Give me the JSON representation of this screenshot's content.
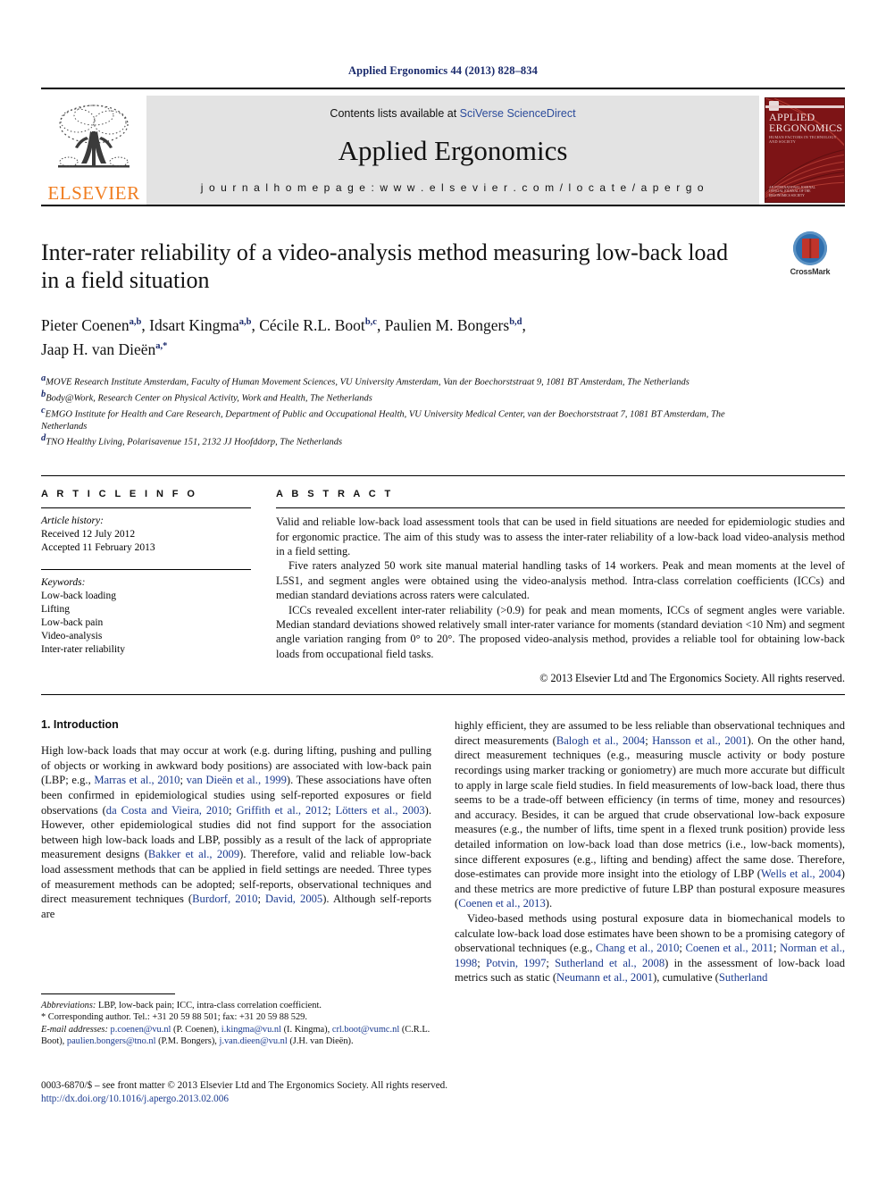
{
  "running_head": "Applied Ergonomics 44 (2013) 828–834",
  "banner": {
    "publisher_name": "ELSEVIER",
    "contents_prefix": "Contents lists available at ",
    "contents_link": "SciVerse ScienceDirect",
    "journal_title": "Applied Ergonomics",
    "homepage": "j o u r n a l   h o m e p a g e :   w w w . e l s e v i e r . c o m / l o c a t e / a p e r g o",
    "cover": {
      "title_line1": "APPLIED",
      "title_line2": "ERGONOMICS",
      "subtitle": "HUMAN FACTORS IN TECHNOLOGY AND SOCIETY",
      "footer": "AN INTERNATIONAL JOURNAL\nOFFICIAL JOURNAL OF THE ERGONOMICS SOCIETY"
    }
  },
  "article": {
    "title": "Inter-rater reliability of a video-analysis method measuring low-back load in a field situation",
    "crossmark_label": "CrossMark",
    "authors": [
      {
        "name": "Pieter Coenen",
        "sup": "a,b",
        "sep": ", "
      },
      {
        "name": "Idsart Kingma",
        "sup": "a,b",
        "sep": ", "
      },
      {
        "name": "Cécile R.L. Boot",
        "sup": "b,c",
        "sep": ", "
      },
      {
        "name": "Paulien M. Bongers",
        "sup": "b,d",
        "sep": ", "
      },
      {
        "name": "Jaap H. van Dieën",
        "sup": "a,*",
        "sep": ""
      }
    ],
    "affiliations": [
      {
        "sup": "a",
        "text": "MOVE Research Institute Amsterdam, Faculty of Human Movement Sciences, VU University Amsterdam, Van der Boechorststraat 9, 1081 BT Amsterdam, The Netherlands"
      },
      {
        "sup": "b",
        "text": "Body@Work, Research Center on Physical Activity, Work and Health, The Netherlands"
      },
      {
        "sup": "c",
        "text": "EMGO Institute for Health and Care Research, Department of Public and Occupational Health, VU University Medical Center, van der Boechorststraat 7, 1081 BT Amsterdam, The Netherlands"
      },
      {
        "sup": "d",
        "text": "TNO Healthy Living, Polarisavenue 151, 2132 JJ Hoofddorp, The Netherlands"
      }
    ]
  },
  "article_info": {
    "heading": "A R T I C L E  I N F O",
    "history_label": "Article history:",
    "received": "Received 12 July 2012",
    "accepted": "Accepted 11 February 2013",
    "keywords_label": "Keywords:",
    "keywords": [
      "Low-back loading",
      "Lifting",
      "Low-back pain",
      "Video-analysis",
      "Inter-rater reliability"
    ]
  },
  "abstract": {
    "heading": "A B S T R A C T",
    "paragraphs": [
      "Valid and reliable low-back load assessment tools that can be used in field situations are needed for epidemiologic studies and for ergonomic practice. The aim of this study was to assess the inter-rater reliability of a low-back load video-analysis method in a field setting.",
      "Five raters analyzed 50 work site manual material handling tasks of 14 workers. Peak and mean moments at the level of L5S1, and segment angles were obtained using the video-analysis method. Intra-class correlation coefficients (ICCs) and median standard deviations across raters were calculated.",
      "ICCs revealed excellent inter-rater reliability (>0.9) for peak and mean moments, ICCs of segment angles were variable. Median standard deviations showed relatively small inter-rater variance for moments (standard deviation <10 Nm) and segment angle variation ranging from 0° to 20°. The proposed video-analysis method, provides a reliable tool for obtaining low-back loads from occupational field tasks."
    ],
    "copyright": "© 2013 Elsevier Ltd and The Ergonomics Society. All rights reserved."
  },
  "introduction": {
    "section_number_title": "1.  Introduction",
    "left_column_html": "High low-back loads that may occur at work (e.g. during lifting, pushing and pulling of objects or working in awkward body positions) are associated with low-back pain (LBP; e.g., <span class=\"cit\">Marras et al., 2010</span>; <span class=\"cit\">van Dieën et al., 1999</span>). These associations have often been confirmed in epidemiological studies using self-reported exposures or field observations (<span class=\"cit\">da Costa and Vieira, 2010</span>; <span class=\"cit\">Griffith et al., 2012</span>; <span class=\"cit\">Lötters et al., 2003</span>). However, other epidemiological studies did not find support for the association between high low-back loads and LBP, possibly as a result of the lack of appropriate measurement designs (<span class=\"cit\">Bakker et al., 2009</span>). Therefore, valid and reliable low-back load assessment methods that can be applied in field settings are needed. Three types of measurement methods can be adopted; self-reports, observational techniques and direct measurement techniques (<span class=\"cit\">Burdorf, 2010</span>; <span class=\"cit\">David, 2005</span>). Although self-reports are",
    "right_column_html_1": "highly efficient, they are assumed to be less reliable than observational techniques and direct measurements (<span class=\"cit\">Balogh et al., 2004</span>; <span class=\"cit\">Hansson et al., 2001</span>). On the other hand, direct measurement techniques (e.g., measuring muscle activity or body posture recordings using marker tracking or goniometry) are much more accurate but difficult to apply in large scale field studies. In field measurements of low-back load, there thus seems to be a trade-off between efficiency (in terms of time, money and resources) and accuracy. Besides, it can be argued that crude observational low-back exposure measures (e.g., the number of lifts, time spent in a flexed trunk position) provide less detailed information on low-back load than dose metrics (i.e., low-back moments), since different exposures (e.g., lifting and bending) affect the same dose. Therefore, dose-estimates can provide more insight into the etiology of LBP (<span class=\"cit\">Wells et al., 2004</span>) and these metrics are more predictive of future LBP than postural exposure measures (<span class=\"cit\">Coenen et al., 2013</span>).",
    "right_column_html_2": "Video-based methods using postural exposure data in biomechanical models to calculate low-back load dose estimates have been shown to be a promising category of observational techniques (e.g., <span class=\"cit\">Chang et al., 2010</span>; <span class=\"cit\">Coenen et al., 2011</span>; <span class=\"cit\">Norman et al., 1998</span>; <span class=\"cit\">Potvin, 1997</span>; <span class=\"cit\">Sutherland et al., 2008</span>) in the assessment of low-back load metrics such as static (<span class=\"cit\">Neumann et al., 2001</span>), cumulative (<span class=\"cit\">Sutherland</span>"
  },
  "footnotes": {
    "abbreviations_label": "Abbreviations:",
    "abbreviations_text": " LBP, low-back pain; ICC, intra-class correlation coefficient.",
    "corresponding": "* Corresponding author. Tel.: +31 20 59 88 501; fax: +31 20 59 88 529.",
    "email_label": "E-mail addresses:",
    "emails_html": " <span class=\"fn-link\">p.coenen@vu.nl</span> (P. Coenen), <span class=\"fn-link\">i.kingma@vu.nl</span> (I. Kingma), <span class=\"fn-link\">crl.boot@vumc.nl</span> (C.R.L. Boot), <span class=\"fn-link\">paulien.bongers@tno.nl</span> (P.M. Bongers), <span class=\"fn-link\">j.van.dieen@vu.nl</span> (J.H. van Dieën)."
  },
  "page_footer": {
    "issn_line": "0003-6870/$ – see front matter © 2013 Elsevier Ltd and The Ergonomics Society. All rights reserved.",
    "doi": "http://dx.doi.org/10.1016/j.apergo.2013.02.006"
  }
}
